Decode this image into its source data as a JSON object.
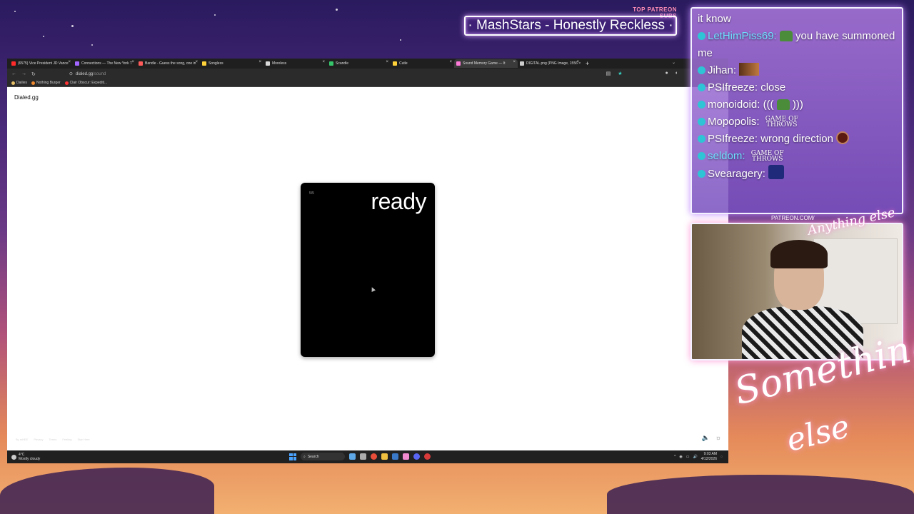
{
  "overlay": {
    "patreon_label": "TOP PATREON SUBS",
    "patreon_name": "· MashStars - Honestly Reckless ·",
    "webcam_label": "PATREON.COM/",
    "webcam_logo_text": "Anything else",
    "big_logo_line1": "Something",
    "big_logo_line2": "else"
  },
  "browser": {
    "tabs": [
      {
        "label": "(6575) Vice President JD Vance",
        "color": "#ff2a2a"
      },
      {
        "label": "Connections — The New York T",
        "color": "#a066ff"
      },
      {
        "label": "Bandle - Guess the song, one in",
        "color": "#ff5a5a"
      },
      {
        "label": "Songless",
        "color": "#ffd23a"
      },
      {
        "label": "Moreless",
        "color": "#d8d8d8"
      },
      {
        "label": "Scandle",
        "color": "#36c46a"
      },
      {
        "label": "Cutle",
        "color": "#ffd23a"
      },
      {
        "label": "Sound Memory Game — It",
        "color": "#ff7ad9",
        "active": true
      },
      {
        "label": "DIGITAL.png (PNG Image, 1556 × 1)",
        "color": "#cccccc"
      }
    ],
    "url_domain": "dialed.gg",
    "url_path": "/sound",
    "bookmarks": [
      {
        "label": "Dailies",
        "color": "#e6c067"
      },
      {
        "label": "Nothing Burger",
        "color": "#f08a30"
      },
      {
        "label": "Clair Obscur: Expediti...",
        "color": "#ff3333"
      }
    ]
  },
  "page": {
    "brand": "Dialed.gg",
    "card": {
      "counter": "5/5",
      "status": "ready"
    },
    "footer_links": [
      "By mHEE",
      "Privacy",
      "Terms",
      "Feeling",
      "Star Here"
    ]
  },
  "taskbar": {
    "temperature": "4°C",
    "weather": "Mostly cloudy",
    "search_label": "Search",
    "time": "9:03 AM",
    "date": "4/12/2026"
  },
  "chat": {
    "messages": [
      {
        "name": "",
        "text": "it know",
        "continuation": true
      },
      {
        "name": "LetHimPiss69:",
        "text": "you have summoned me",
        "name_color": "blue",
        "emote": "frog"
      },
      {
        "name": "Jihan:",
        "text": "",
        "emote": "pic"
      },
      {
        "name": "PSIfreeze:",
        "text": "close"
      },
      {
        "name": "monoidoid:",
        "text": "((( ",
        "emote": "frog",
        "after": " )))"
      },
      {
        "name": "Mopopolis:",
        "text": "",
        "emote_text": "GAME OF THROWS"
      },
      {
        "name": "PSIfreeze:",
        "text": "wrong direction",
        "emote": "ball"
      },
      {
        "name": "seldom:",
        "text": "",
        "name_color": "blue",
        "emote_text": "GAME OF THROWS"
      },
      {
        "name": "Svearagery:",
        "text": "",
        "emote": "wiz"
      }
    ]
  }
}
